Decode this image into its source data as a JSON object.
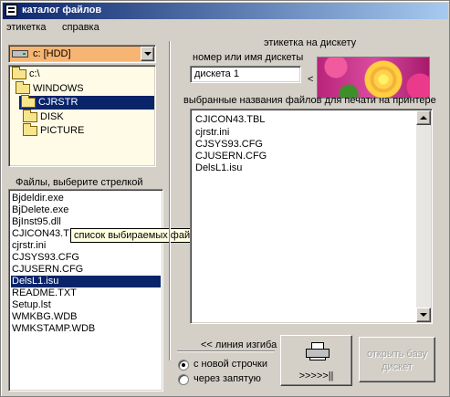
{
  "window": {
    "title": "каталог файлов"
  },
  "menu": [
    "этикетка",
    "справка"
  ],
  "drive": {
    "selected": "c: [HDD]"
  },
  "folder_tree": [
    {
      "label": "c:\\",
      "open": true,
      "selected": false
    },
    {
      "label": "WINDOWS",
      "open": true,
      "selected": false
    },
    {
      "label": "CJRSTR",
      "open": true,
      "selected": true
    },
    {
      "label": "DISK",
      "open": false,
      "selected": false
    },
    {
      "label": "PICTURE",
      "open": false,
      "selected": false
    }
  ],
  "files_section": {
    "label": "Файлы, выберите стрелкой",
    "items": [
      "Bjdeldir.exe",
      "BjDelete.exe",
      "BjInst95.dll",
      "CJICON43.TBL",
      "cjrstr.ini",
      "CJSYS93.CFG",
      "CJUSERN.CFG",
      "DelsL1.isu",
      "README.TXT",
      "Setup.lst",
      "WMKBG.WDB",
      "WMKSTAMP.WDB"
    ],
    "selected": "DelsL1.isu",
    "tooltip": "список выбираемых файлов"
  },
  "disk_label": {
    "group_label": "этикетка на дискету",
    "field_label": "номер или имя дискеты",
    "value": "дискета 1",
    "arrow": "<"
  },
  "print_section": {
    "label": "выбранные названия файлов для печати на принтере",
    "items": [
      "CJICON43.TBL",
      "cjrstr.ini",
      "CJSYS93.CFG",
      "CJUSERN.CFG",
      "DelsL1.isu"
    ]
  },
  "bend_line_label": "<< линия изгиба",
  "options": [
    {
      "label": "с новой строчки",
      "checked": true
    },
    {
      "label": "через запятую",
      "checked": false
    }
  ],
  "print_button": {
    "label": ">>>>>||"
  },
  "open_db_button": {
    "line1": "открыть базу",
    "line2": "дискет",
    "enabled": false
  }
}
